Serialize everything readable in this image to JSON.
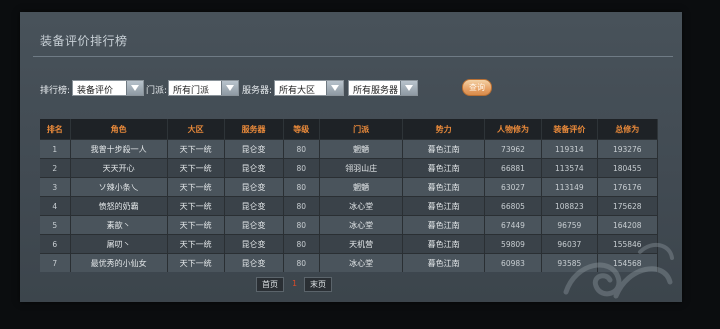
{
  "page": {
    "title": "装备评价排行榜"
  },
  "filters": {
    "ranking_label": "排行榜:",
    "ranking_value": "装备评价",
    "sect_label": "门派:",
    "sect_value": "所有门派",
    "server_label": "服务器:",
    "region_value": "所有大区",
    "server_value": "所有服务器",
    "query_label": "查询"
  },
  "table": {
    "headers": [
      "排名",
      "角色",
      "大区",
      "服务器",
      "等级",
      "门派",
      "势力",
      "人物修为",
      "装备评价",
      "总修为"
    ],
    "rows": [
      [
        "1",
        "我曾十步殺一人",
        "天下一统",
        "昆仑变",
        "80",
        "魍魉",
        "暮色江南",
        "73962",
        "119314",
        "193276"
      ],
      [
        "2",
        "天天开心",
        "天下一统",
        "昆仑变",
        "80",
        "翎羽山庄",
        "暮色江南",
        "66881",
        "113574",
        "180455"
      ],
      [
        "3",
        "ソ辣小条乀",
        "天下一统",
        "昆仑变",
        "80",
        "魍魉",
        "暮色江南",
        "63027",
        "113149",
        "176176"
      ],
      [
        "4",
        "愤怒的奶霸",
        "天下一统",
        "昆仑变",
        "80",
        "冰心堂",
        "暮色江南",
        "66805",
        "108823",
        "175628"
      ],
      [
        "5",
        "素歆丶",
        "天下一统",
        "昆仑变",
        "80",
        "冰心堂",
        "暮色江南",
        "67449",
        "96759",
        "164208"
      ],
      [
        "6",
        "屠叨丶",
        "天下一统",
        "昆仑变",
        "80",
        "天机营",
        "暮色江南",
        "59809",
        "96037",
        "155846"
      ],
      [
        "7",
        "最优秀的小仙女",
        "天下一统",
        "昆仑变",
        "80",
        "冰心堂",
        "暮色江南",
        "60983",
        "93585",
        "154568"
      ]
    ]
  },
  "pager": {
    "first_label": "首页",
    "current_page": "1",
    "last_label": "末页"
  },
  "colors": {
    "header_text": "#e8893a",
    "current_page": "#d84a2a",
    "query_button": "#e8a56a"
  },
  "icons": [
    "dropdown-arrow-icon",
    "cloud-swirl-decoration"
  ]
}
